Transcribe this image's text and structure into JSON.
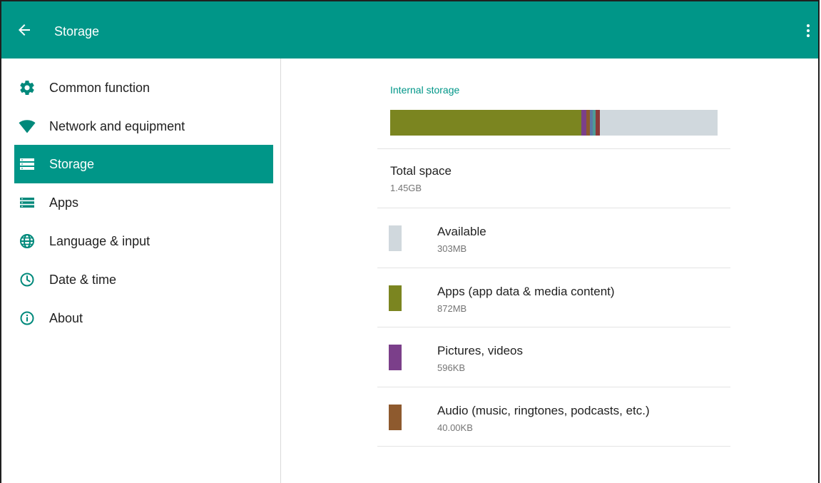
{
  "appbar": {
    "title": "Storage",
    "color": "#009688"
  },
  "sidebar": {
    "items": [
      {
        "label": "Common function",
        "icon": "gear-icon",
        "selected": false
      },
      {
        "label": "Network and equipment",
        "icon": "wifi-icon",
        "selected": false
      },
      {
        "label": "Storage",
        "icon": "storage-icon",
        "selected": true
      },
      {
        "label": "Apps",
        "icon": "apps-list-icon",
        "selected": false
      },
      {
        "label": "Language & input",
        "icon": "globe-icon",
        "selected": false
      },
      {
        "label": "Date & time",
        "icon": "clock-icon",
        "selected": false
      },
      {
        "label": "About",
        "icon": "info-icon",
        "selected": false
      }
    ]
  },
  "storage": {
    "section_title": "Internal storage",
    "total_label": "Total space",
    "total_value": "1.45GB",
    "bar_segments": [
      {
        "name": "apps",
        "fraction": 0.584,
        "color": "#7b8520"
      },
      {
        "name": "pictures",
        "fraction": 0.016,
        "color": "#7b3f8a"
      },
      {
        "name": "audio",
        "fraction": 0.009,
        "color": "#8e5a2e"
      },
      {
        "name": "other-blue",
        "fraction": 0.009,
        "color": "#5b79a6"
      },
      {
        "name": "other-teal",
        "fraction": 0.009,
        "color": "#4f9a96"
      },
      {
        "name": "other-red",
        "fraction": 0.013,
        "color": "#8c3a3a"
      },
      {
        "name": "available",
        "fraction": 0.36,
        "color": "#d0d8dd"
      }
    ],
    "categories": [
      {
        "title": "Available",
        "value": "303MB",
        "color": "#d0d8dd"
      },
      {
        "title": "Apps (app data & media content)",
        "value": "872MB",
        "color": "#7b8520"
      },
      {
        "title": "Pictures, videos",
        "value": "596KB",
        "color": "#7b3f8a"
      },
      {
        "title": "Audio (music, ringtones, podcasts, etc.)",
        "value": "40.00KB",
        "color": "#8e5a2e"
      }
    ]
  }
}
